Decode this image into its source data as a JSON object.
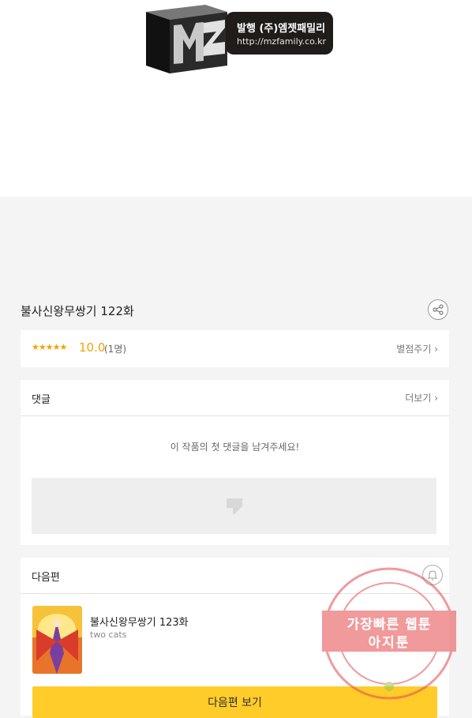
{
  "logo": {
    "mark": "MZ",
    "publisher": "발행 (주)엠젯패밀리",
    "url": "http://mzfamily.co.kr"
  },
  "episode": {
    "title": "불사신왕무쌍기 122화",
    "share_icon": "share-icon"
  },
  "rating": {
    "stars": "★★★★★",
    "score": "10.0",
    "count": "(1명)",
    "action_label": "별점주기 ›"
  },
  "comments": {
    "title": "댓글",
    "more_label": "더보기 ›",
    "empty_message": "이 작품의 첫 댓글을 남겨주세요!",
    "input_icon": "comment-icon"
  },
  "next_episode": {
    "section_title": "다음편",
    "bell_icon": "bell-icon",
    "title": "불사신왕무쌍기 123화",
    "author": "two cats",
    "button_label": "다음편 보기"
  },
  "watermark": {
    "line1": "가장빠른 웹툰",
    "line2": "아지툰"
  },
  "colors": {
    "accent": "#f0a500",
    "button": "#ffcc2a",
    "watermark": "#e5484d"
  }
}
